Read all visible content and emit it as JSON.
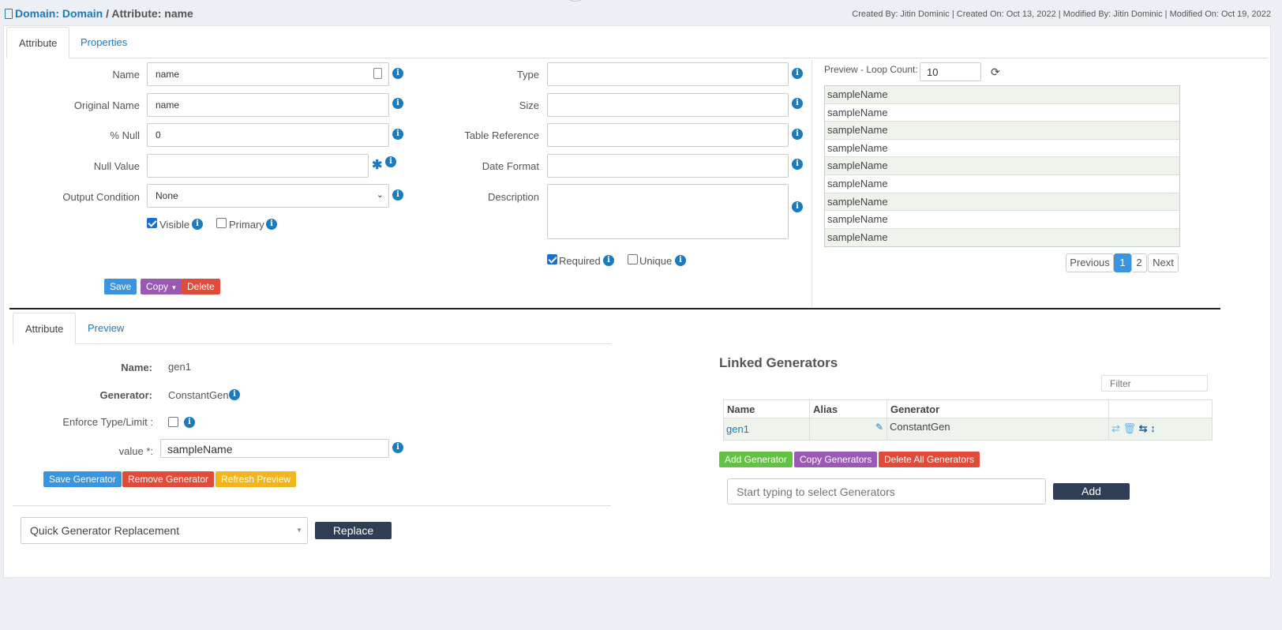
{
  "header": {
    "breadcrumb_domain": "Domain: Domain",
    "breadcrumb_sep": " / ",
    "breadcrumb_attr": "Attribute: name",
    "meta": "Created By: Jitin Dominic | Created On: Oct 13, 2022 | Modified By: Jitin Dominic | Modified On: Oct 19, 2022"
  },
  "top_tabs": [
    "Attribute",
    "Properties"
  ],
  "form": {
    "name_label": "Name",
    "name_value": "name",
    "original_name_label": "Original Name",
    "original_name_value": "name",
    "null_pct_label": "% Null",
    "null_pct_value": "0",
    "null_value_label": "Null Value",
    "null_value_value": "",
    "output_condition_label": "Output Condition",
    "output_condition_value": "None",
    "visible_label": "Visible",
    "visible_checked": true,
    "primary_label": "Primary",
    "primary_checked": false,
    "type_label": "Type",
    "size_label": "Size",
    "table_reference_label": "Table Reference",
    "date_format_label": "Date Format",
    "description_label": "Description",
    "required_label": "Required",
    "required_checked": true,
    "unique_label": "Unique",
    "unique_checked": false
  },
  "actions": {
    "save": "Save",
    "copy": "Copy",
    "delete": "Delete"
  },
  "preview": {
    "loop_count_label": "Preview - Loop Count:",
    "loop_count_value": "10",
    "rows": [
      "sampleName",
      "sampleName",
      "sampleName",
      "sampleName",
      "sampleName",
      "sampleName",
      "sampleName",
      "sampleName",
      "sampleName"
    ],
    "pagination": {
      "previous": "Previous",
      "pages": [
        "1",
        "2"
      ],
      "current": "1",
      "next": "Next"
    }
  },
  "generator_tabs": [
    "Attribute",
    "Preview"
  ],
  "generator": {
    "name_label": "Name:",
    "name_value": "gen1",
    "generator_label": "Generator:",
    "generator_value": "ConstantGen",
    "enforce_label": "Enforce Type/Limit :",
    "enforce_checked": false,
    "value_label": "value *:",
    "value_value": "sampleName",
    "save_button": "Save Generator",
    "remove_button": "Remove Generator",
    "refresh_button": "Refresh Preview",
    "quick_replace_value": "Quick Generator Replacement",
    "replace_button": "Replace"
  },
  "linked": {
    "title": "Linked Generators",
    "filter_placeholder": "Filter",
    "columns": [
      "Name",
      "Alias",
      "Generator",
      ""
    ],
    "rows": [
      {
        "name": "gen1",
        "alias": "",
        "generator": "ConstantGen"
      }
    ],
    "add_button": "Add Generator",
    "copy_button": "Copy Generators",
    "delete_all_button": "Delete All Generators",
    "select_placeholder": "Start typing to select Generators",
    "add_small_button": "Add"
  },
  "colors": {
    "link": "#1a7bbf",
    "save": "#3a95de",
    "copy": "#9b59b6",
    "delete": "#e04b3a",
    "add": "#62c243",
    "refresh": "#f2b51b",
    "dark_button": "#2f3e55"
  }
}
